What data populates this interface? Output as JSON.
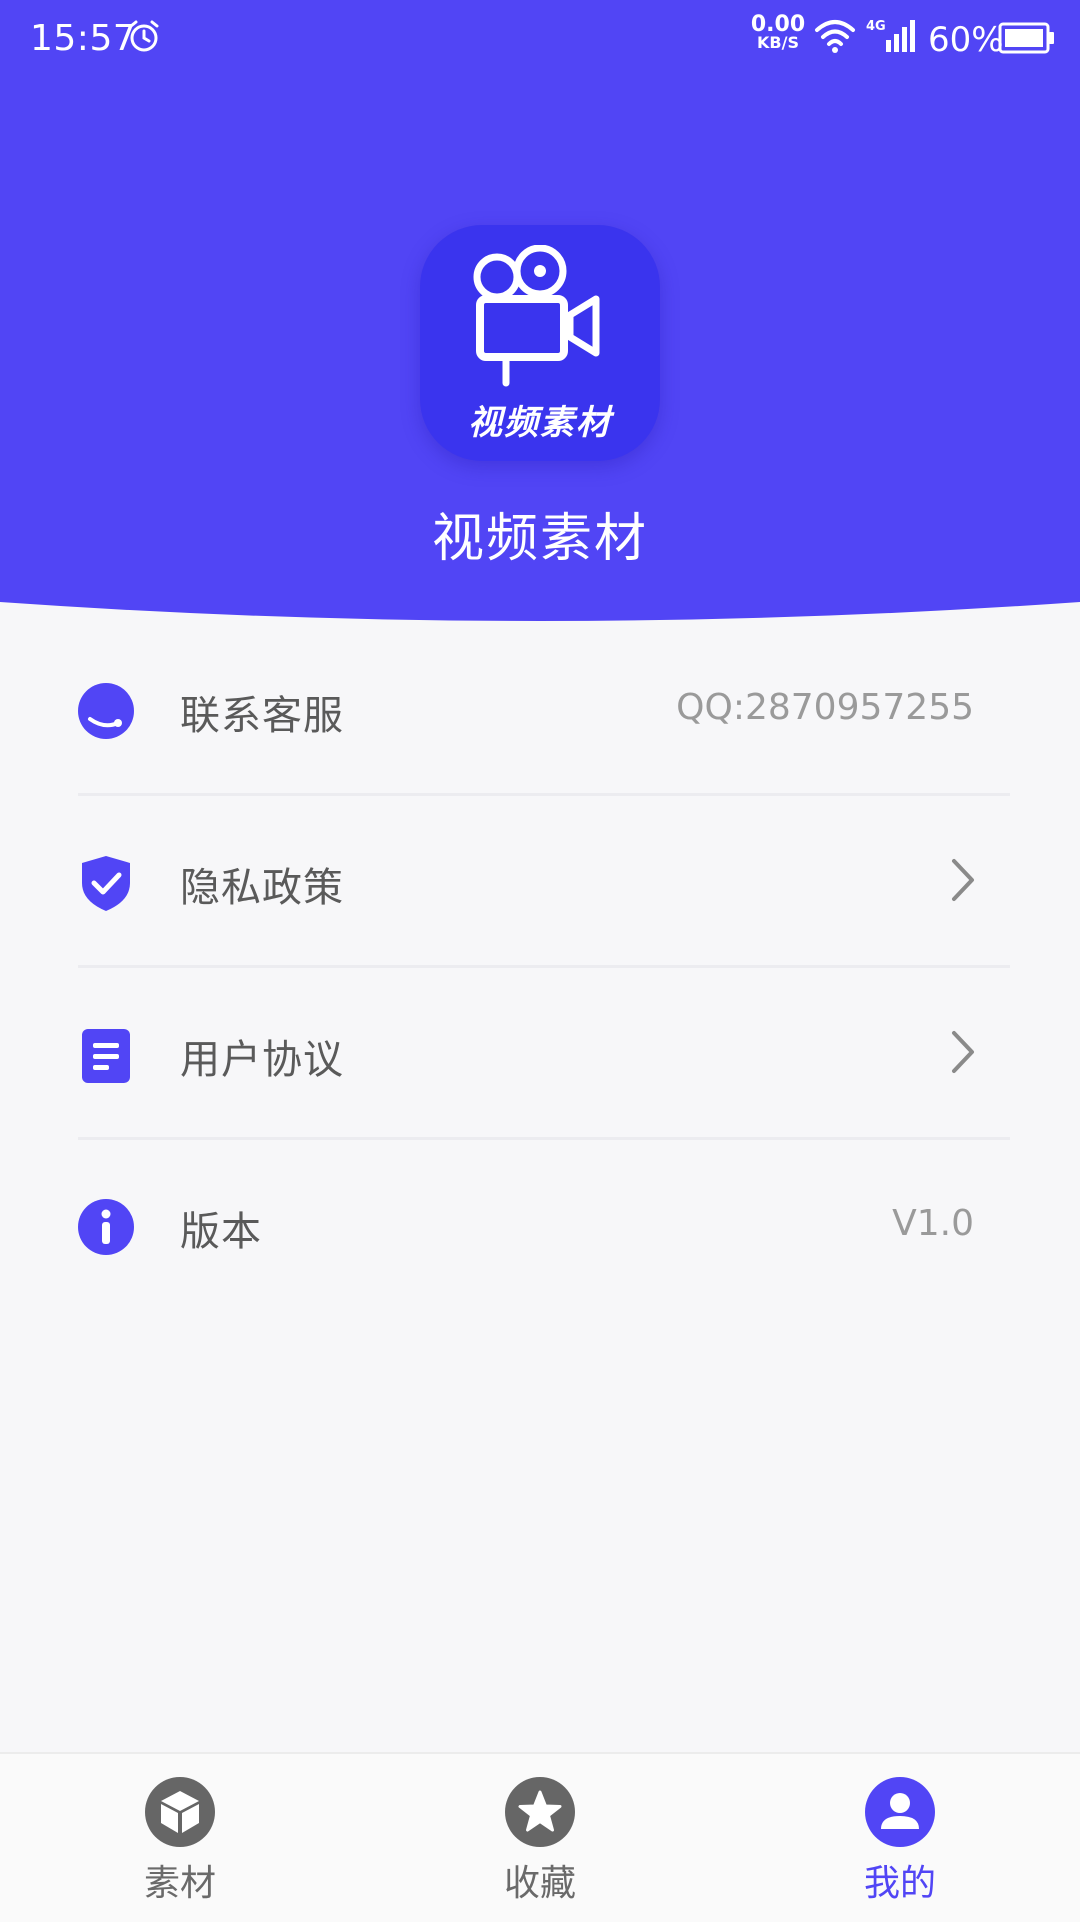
{
  "status_bar": {
    "time": "15:57",
    "net_speed_value": "0.00",
    "net_speed_unit": "KB/S",
    "network_type": "4G",
    "battery_percent": "60%"
  },
  "header": {
    "logo_text": "视频素材",
    "app_name": "视频素材",
    "background_color": "#5145f5",
    "logo_color": "#3a34ee"
  },
  "menu": {
    "items": [
      {
        "label": "联系客服",
        "value": "QQ:2870957255",
        "icon": "headset-icon"
      },
      {
        "label": "隐私政策",
        "icon": "shield-check-icon"
      },
      {
        "label": "用户协议",
        "icon": "document-icon"
      },
      {
        "label": "版本",
        "value": "V1.0",
        "icon": "info-icon"
      }
    ]
  },
  "tabs": [
    {
      "label": "素材",
      "icon": "cube-icon",
      "active": false
    },
    {
      "label": "收藏",
      "icon": "star-icon",
      "active": false
    },
    {
      "label": "我的",
      "icon": "user-icon",
      "active": true
    }
  ],
  "colors": {
    "accent": "#5145f5",
    "inactive_icon": "#666666",
    "text_primary": "#5a5a5a",
    "text_secondary": "#9a9a9a"
  }
}
